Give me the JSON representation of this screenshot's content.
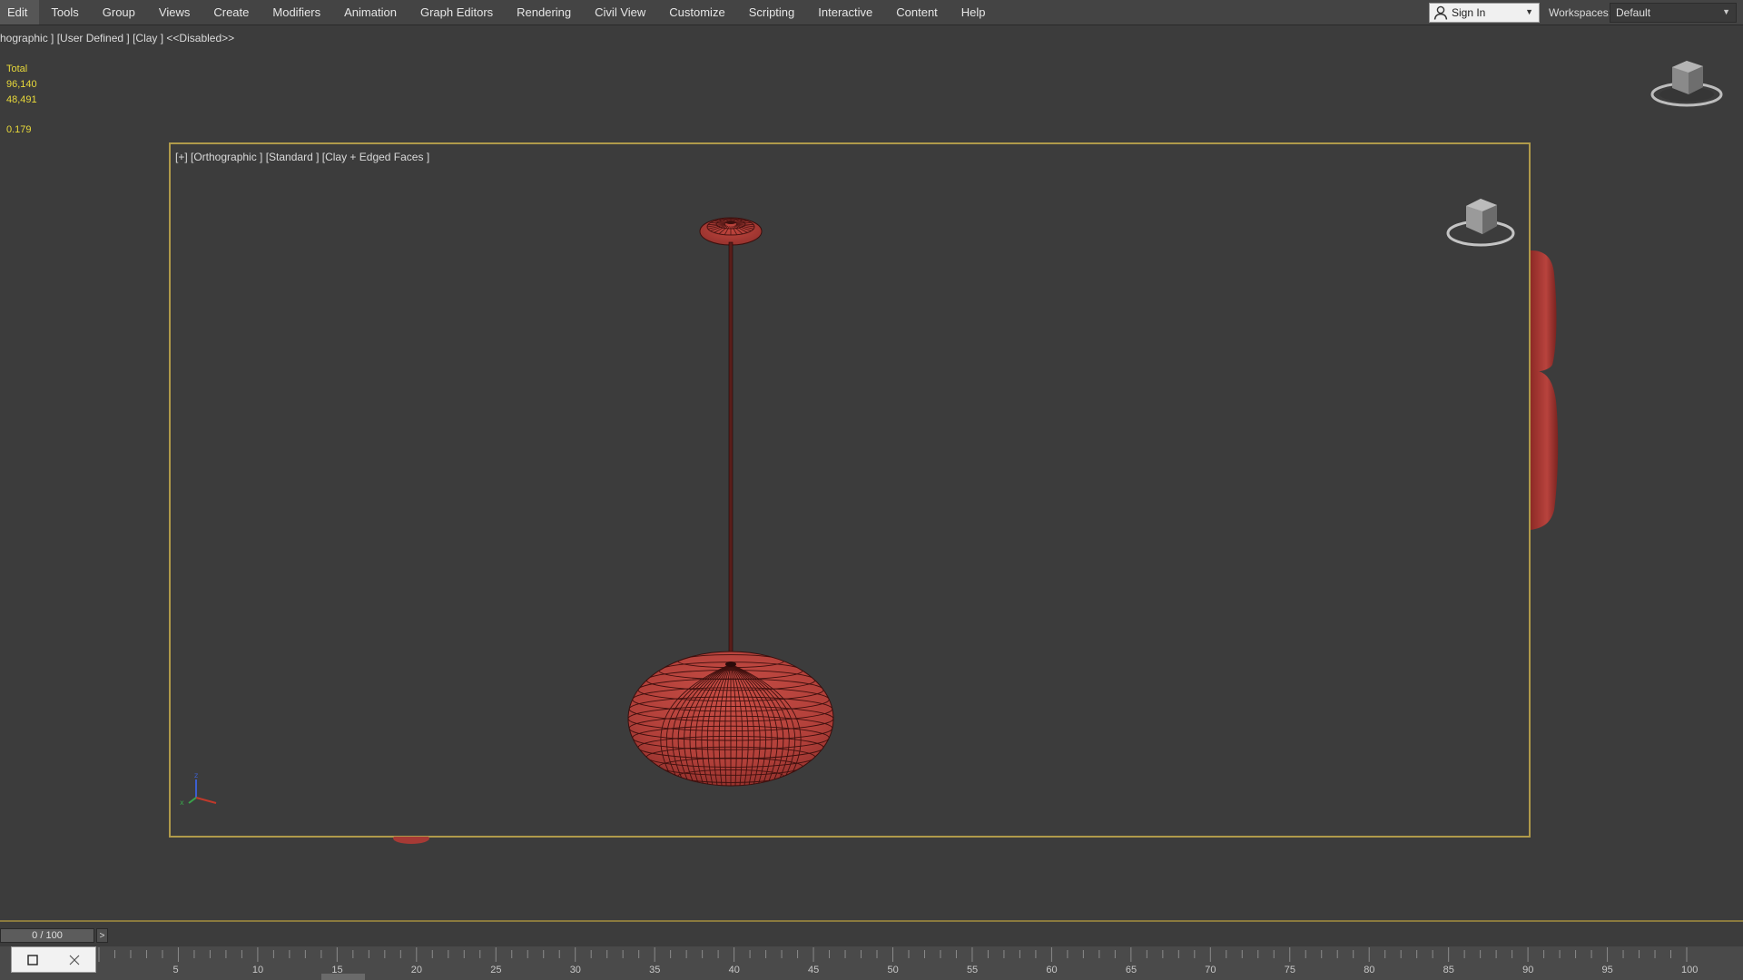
{
  "menu": {
    "items": [
      "Edit",
      "Tools",
      "Group",
      "Views",
      "Create",
      "Modifiers",
      "Animation",
      "Graph Editors",
      "Rendering",
      "Civil View",
      "Customize",
      "Scripting",
      "Interactive",
      "Content",
      "Help"
    ]
  },
  "account": {
    "sign_in_label": "Sign In",
    "workspaces_label": "Workspaces:",
    "workspace_value": "Default"
  },
  "background_viewport": {
    "label": "hographic ] [User Defined ] [Clay ]  <<Disabled>>",
    "stats": {
      "total_label": "Total",
      "polys": "96,140",
      "verts": "48,491",
      "fps": "0.179"
    }
  },
  "active_viewport": {
    "label": "[+] [Orthographic ] [Standard ] [Clay + Edged Faces ]"
  },
  "timeline": {
    "frame_display": "0 / 100",
    "next_label": ">",
    "tick_labels": [
      "5",
      "10",
      "15",
      "20",
      "25",
      "30",
      "35",
      "40",
      "45",
      "50",
      "55",
      "60",
      "65",
      "70",
      "75",
      "80",
      "85",
      "90",
      "95",
      "100"
    ]
  },
  "colors": {
    "menu_bg": "#444444",
    "viewport_bg": "#3c3c3c",
    "active_border": "#b09a4a",
    "stats_text": "#e8d93a",
    "clay": "#b8433d"
  },
  "icons": {
    "user": "user-icon",
    "viewcube": "viewcube-icon",
    "axis_tripod": "axis-tripod-icon",
    "key_square": "square-icon",
    "close": "close-icon"
  }
}
